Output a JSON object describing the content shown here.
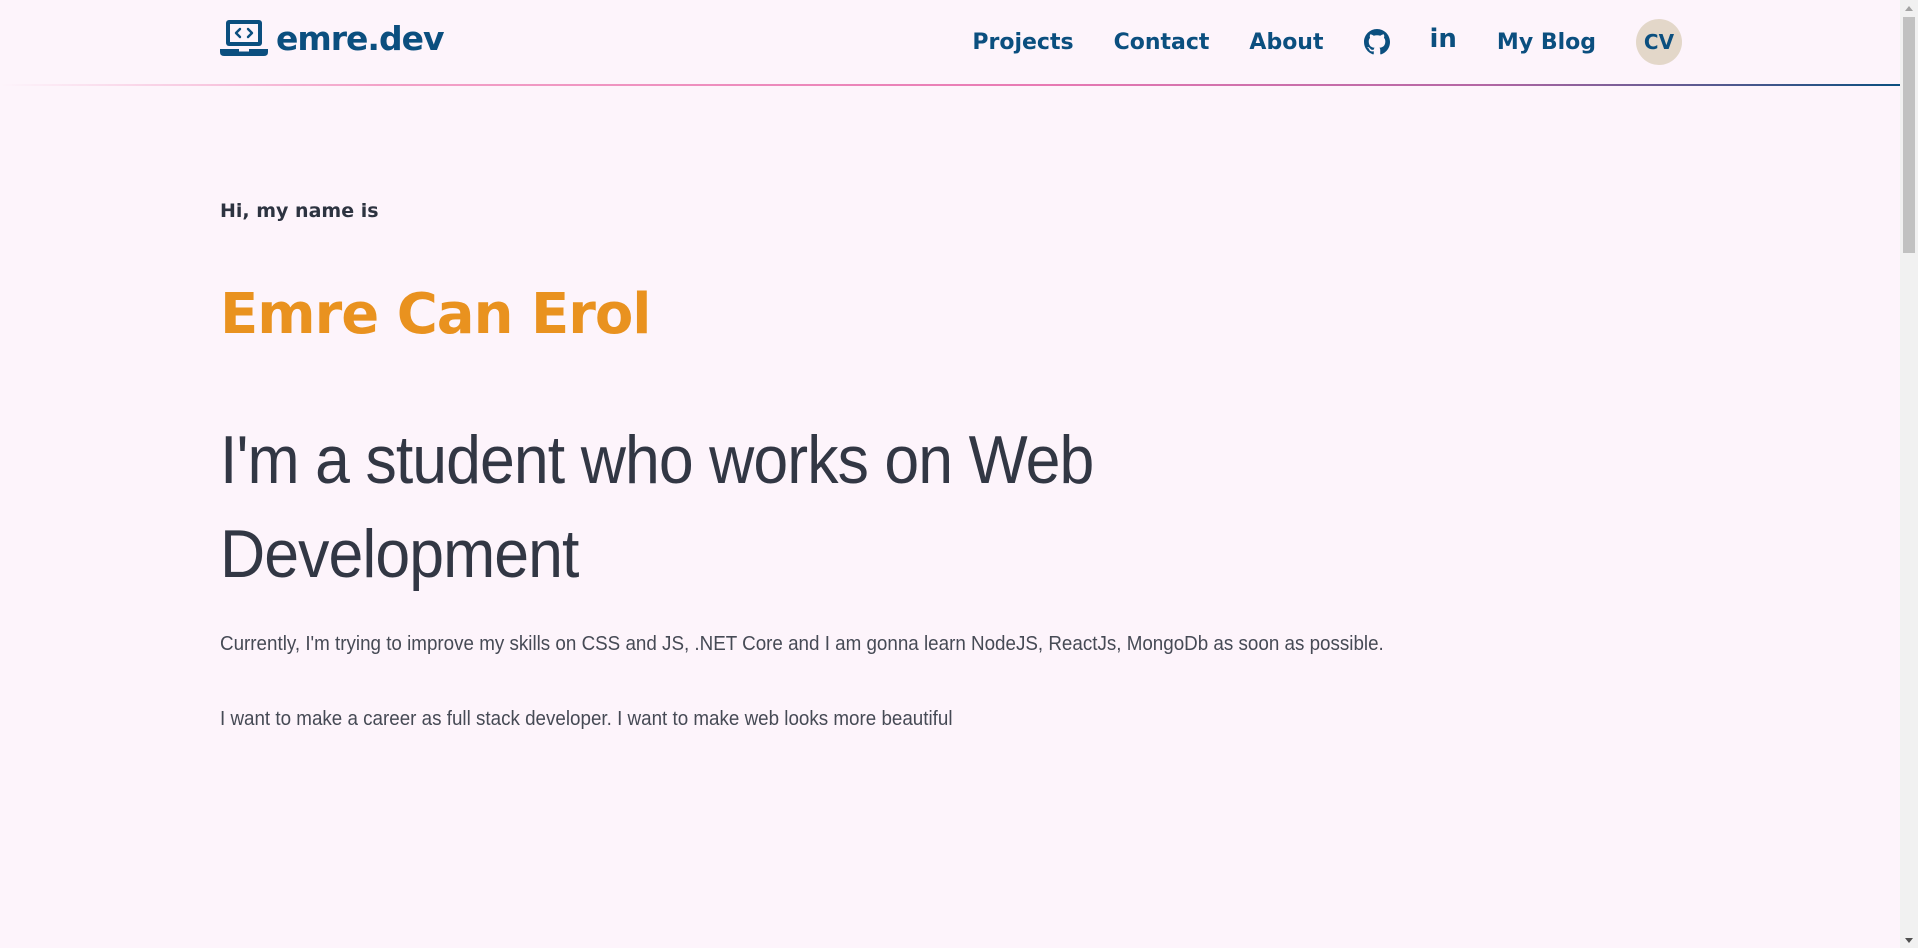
{
  "brand": {
    "name": "emre.dev",
    "icon": "laptop-code-icon"
  },
  "nav": {
    "projects": "Projects",
    "contact": "Contact",
    "about": "About",
    "github_icon": "github-icon",
    "linkedin_icon": "linkedin-icon",
    "linkedin_glyph": "in",
    "blog": "My Blog",
    "cv": "CV"
  },
  "hero": {
    "greeting": "Hi, my name is",
    "name": "Emre Can Erol",
    "tagline": "I'm a student who works on Web Development",
    "paragraph_1": "Currently, I'm trying to improve my skills on CSS and JS, .NET Core and I am gonna learn NodeJS, ReactJs, MongoDb as soon as possible.",
    "paragraph_2": "I want to make a career as full stack developer. I want to make web looks more beautiful"
  },
  "colors": {
    "background": "#fdf4fb",
    "primary": "#0b4f7f",
    "accent": "#e9921f",
    "text": "#323744",
    "cv_badge": "#e3d7c9"
  }
}
